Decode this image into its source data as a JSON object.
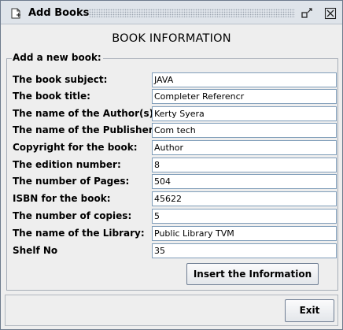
{
  "window": {
    "title": "Add Books",
    "icons": {
      "app": "document-icon",
      "restore": "restore-icon",
      "close": "close-icon"
    }
  },
  "heading": "BOOK INFORMATION",
  "panel": {
    "title": "Add a new book:"
  },
  "fields": [
    {
      "label": "The book subject:",
      "value": "JAVA"
    },
    {
      "label": "The book title:",
      "value": "Completer Referencr"
    },
    {
      "label": "The name of the Author(s):",
      "value": "Kerty Syera"
    },
    {
      "label": "The name of the Publisher:",
      "value": "Com tech"
    },
    {
      "label": "Copyright for the book:",
      "value": "Author"
    },
    {
      "label": "The edition number:",
      "value": "8"
    },
    {
      "label": "The number of Pages:",
      "value": "504"
    },
    {
      "label": "ISBN for the book:",
      "value": "45622"
    },
    {
      "label": "The number of copies:",
      "value": "5"
    },
    {
      "label": "The name of the Library:",
      "value": "Public Library TVM"
    },
    {
      "label": "Shelf No",
      "value": "35"
    }
  ],
  "buttons": {
    "insert": "Insert the Information",
    "exit": "Exit"
  },
  "colors": {
    "field_border": "#7f9db9",
    "window_bg": "#eeeeee",
    "titlebar": "#dfe4ea"
  }
}
